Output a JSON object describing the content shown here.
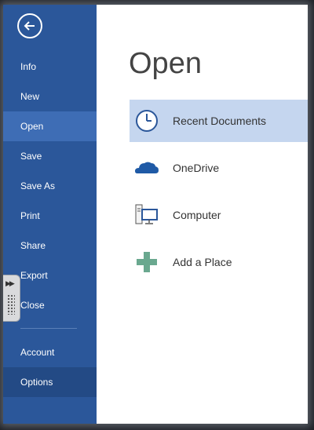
{
  "sidebar": {
    "back_icon": "back-arrow-icon",
    "items": [
      {
        "label": "Info"
      },
      {
        "label": "New"
      },
      {
        "label": "Open",
        "active": true
      },
      {
        "label": "Save"
      },
      {
        "label": "Save As"
      },
      {
        "label": "Print"
      },
      {
        "label": "Share"
      },
      {
        "label": "Export"
      },
      {
        "label": "Close"
      }
    ],
    "bottom_items": [
      {
        "label": "Account"
      },
      {
        "label": "Options"
      }
    ],
    "colors": {
      "background": "#2b579a",
      "active": "#3e6db5",
      "options": "#234a85"
    }
  },
  "main": {
    "title": "Open",
    "locations": [
      {
        "label": "Recent Documents",
        "icon": "clock-icon",
        "selected": true
      },
      {
        "label": "OneDrive",
        "icon": "cloud-icon"
      },
      {
        "label": "Computer",
        "icon": "computer-icon"
      },
      {
        "label": "Add a Place",
        "icon": "plus-icon"
      }
    ],
    "selected_color": "#c5d6ef"
  },
  "handle": {
    "icon": "double-chevron-right-icon"
  }
}
